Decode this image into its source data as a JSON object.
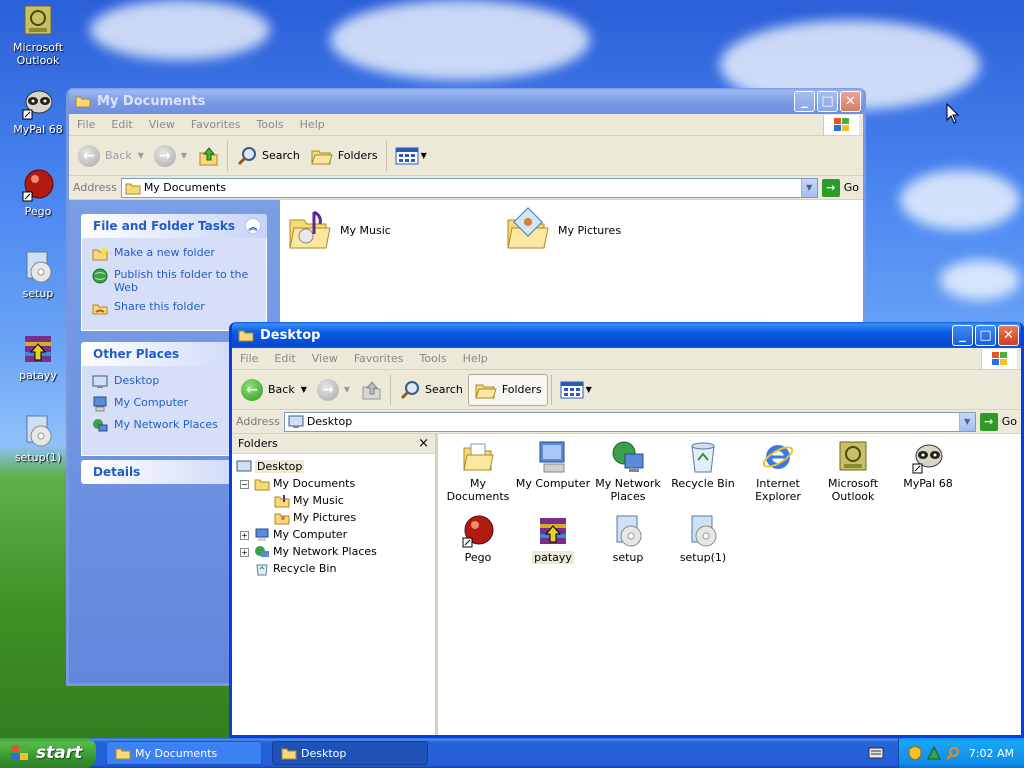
{
  "desktop": {
    "icons": [
      {
        "label": "Microsoft Outlook"
      },
      {
        "label": "MyPal 68"
      },
      {
        "label": "Pego"
      },
      {
        "label": "setup"
      },
      {
        "label": "patayy"
      },
      {
        "label": "setup(1)"
      }
    ]
  },
  "win_mydocs": {
    "title": "My Documents",
    "menu": [
      "File",
      "Edit",
      "View",
      "Favorites",
      "Tools",
      "Help"
    ],
    "toolbar": {
      "back": "Back",
      "search": "Search",
      "folders": "Folders"
    },
    "address_label": "Address",
    "address_value": "My Documents",
    "go": "Go",
    "tasks": {
      "title": "File and Folder Tasks",
      "links": [
        "Make a new folder",
        "Publish this folder to the Web",
        "Share this folder"
      ]
    },
    "other_places": {
      "title": "Other Places",
      "links": [
        "Desktop",
        "My Computer",
        "My Network Places"
      ]
    },
    "details": {
      "title": "Details"
    },
    "items": [
      "My Music",
      "My Pictures"
    ]
  },
  "win_desktop": {
    "title": "Desktop",
    "menu": [
      "File",
      "Edit",
      "View",
      "Favorites",
      "Tools",
      "Help"
    ],
    "toolbar": {
      "back": "Back",
      "search": "Search",
      "folders": "Folders"
    },
    "address_label": "Address",
    "address_value": "Desktop",
    "go": "Go",
    "folders_pane": {
      "title": "Folders",
      "close": "×",
      "nodes": [
        "Desktop",
        "My Documents",
        "My Music",
        "My Pictures",
        "My Computer",
        "My Network Places",
        "Recycle Bin"
      ]
    },
    "items": [
      "My Documents",
      "My Computer",
      "My Network Places",
      "Recycle Bin",
      "Internet Explorer",
      "Microsoft Outlook",
      "MyPal 68",
      "Pego",
      "patayy",
      "setup",
      "setup(1)"
    ]
  },
  "taskbar": {
    "start": "start",
    "buttons": [
      "My Documents",
      "Desktop"
    ],
    "clock": "7:02 AM"
  },
  "colors": {
    "titlebar_active": "#0a5ce6",
    "task_link": "#215dc6",
    "start_green": "#3c9e38"
  }
}
